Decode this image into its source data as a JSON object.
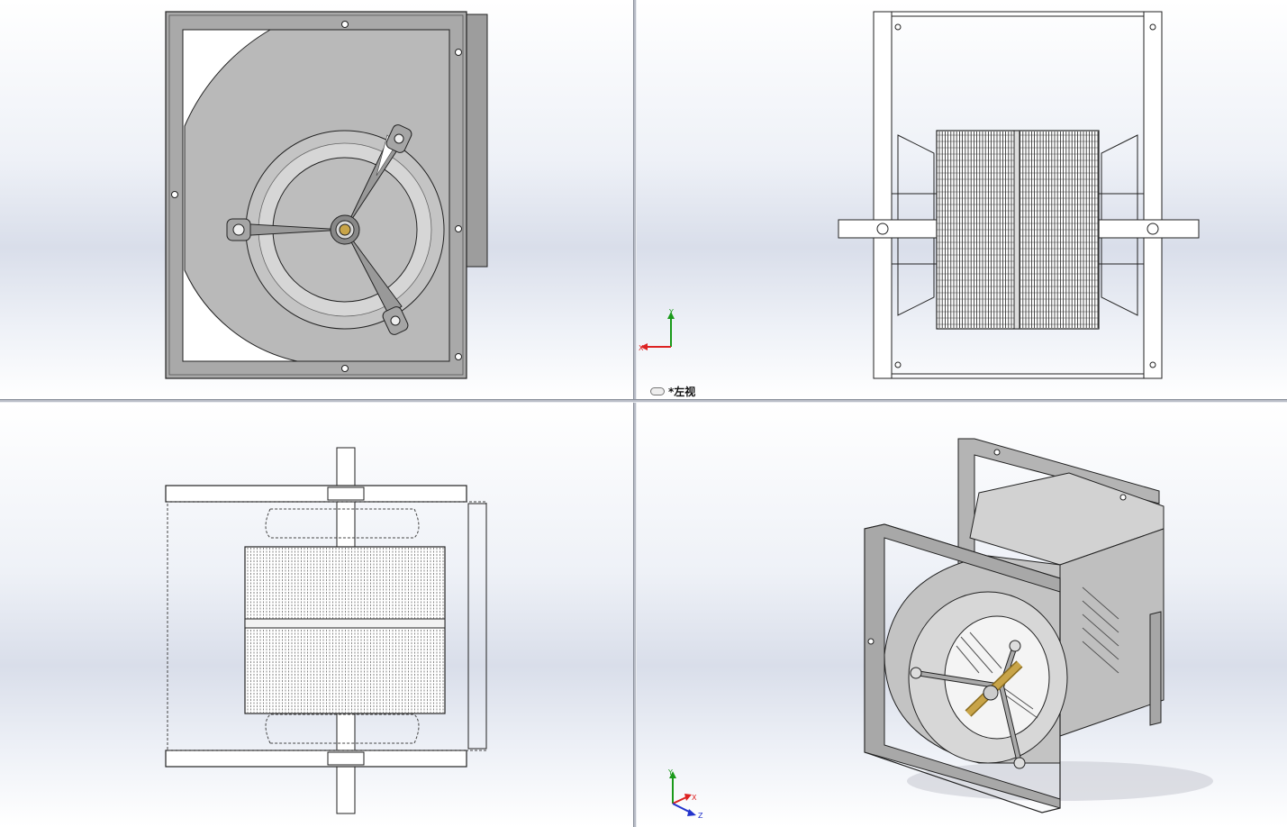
{
  "viewports": {
    "top_left": {
      "name": "front-view"
    },
    "top_right": {
      "name": "left-view",
      "label": "*左视",
      "triad": {
        "y": "Y",
        "x": "X"
      }
    },
    "bottom_left": {
      "name": "top-view"
    },
    "bottom_right": {
      "name": "isometric-view",
      "triad": {
        "y": "Y",
        "x": "X",
        "z": "Z"
      }
    }
  },
  "colors": {
    "steel": "#b9b9b9",
    "steel_dark": "#8f8f8f",
    "outline": "#1a1a1a",
    "shaft_brass": "#c8a448",
    "background_light": "#ffffff",
    "background_band": "#d9deea"
  }
}
